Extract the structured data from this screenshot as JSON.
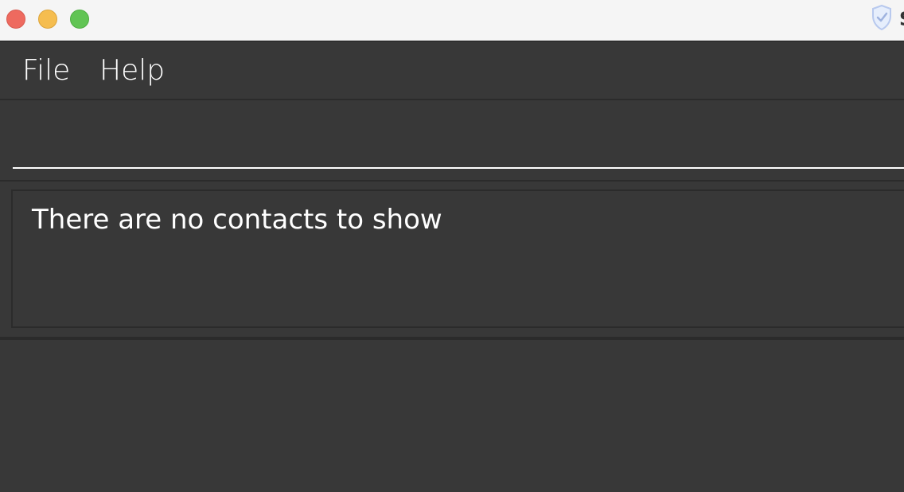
{
  "window": {
    "title_partial": "S",
    "controls": {
      "close": "close-button",
      "minimize": "minimize-button",
      "maximize": "maximize-button"
    },
    "status_icon": "shield-check-icon"
  },
  "menubar": {
    "items": [
      {
        "label": "File"
      },
      {
        "label": "Help"
      }
    ]
  },
  "command_box": {
    "value": "",
    "placeholder": ""
  },
  "result_display": {
    "message": "There are no contacts to show"
  },
  "colors": {
    "background": "#383838",
    "border": "#2b2b2b",
    "text": "#ffffff",
    "close": "#ee6a5f",
    "minimize": "#f5bd4f",
    "maximize": "#61c454"
  }
}
